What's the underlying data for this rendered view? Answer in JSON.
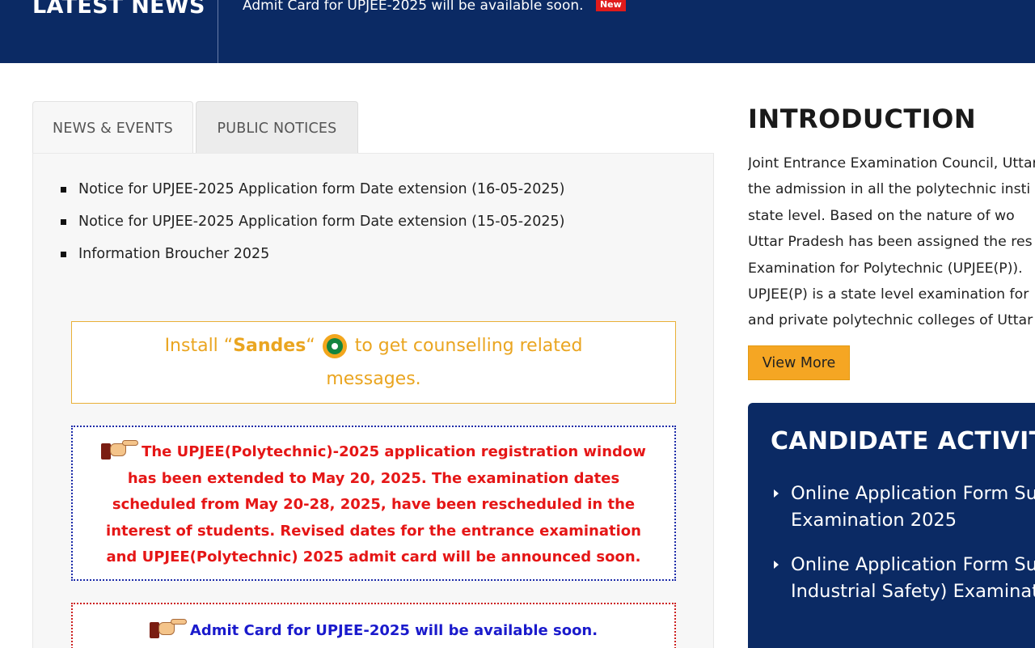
{
  "news_bar": {
    "title": "LATEST NEWS",
    "item": "Admit Card for UPJEE-2025 will be available soon.",
    "badge": "New"
  },
  "tabs": [
    {
      "label": "NEWS & EVENTS",
      "active": true
    },
    {
      "label": "PUBLIC NOTICES",
      "active": false
    }
  ],
  "notices": [
    "Notice for UPJEE-2025 Application form Date extension (16-05-2025)",
    "Notice for UPJEE-2025 Application form Date extension (15-05-2025)",
    "Information Broucher 2025"
  ],
  "sandes": {
    "prefix": "Install “",
    "app_name": "Sandes",
    "suffix_quote": "“",
    "message_line1": "to get counselling related",
    "message_line2": "messages."
  },
  "alert": {
    "text": "The UPJEE(Polytechnic)-2025 application registration window has been extended to May 20, 2025. The examination dates scheduled from May 20-28, 2025, have been rescheduled in the interest of students. Revised dates for the entrance examination and UPJEE(Polytechnic) 2025 admit card will be announced soon."
  },
  "admit_notice": {
    "text": "Admit Card for UPJEE-2025 will be available soon."
  },
  "introduction": {
    "title": "INTRODUCTION",
    "lines": [
      "Joint Entrance Examination Council, Uttar",
      "the admission in all the polytechnic insti",
      "state level. Based on the nature of wo",
      "Uttar Pradesh has been assigned the res",
      "Examination for Polytechnic (UPJEE(P)).",
      "UPJEE(P) is a state level examination for",
      "and private polytechnic colleges of Uttar"
    ],
    "view_more": "View More"
  },
  "candidate_activity": {
    "title": "CANDIDATE ACTIVITY",
    "items": [
      {
        "line1": "Online Application Form Su",
        "line2": "Examination 2025"
      },
      {
        "line1": "Online Application Form Su",
        "line2": "Industrial Safety) Examinat"
      }
    ]
  },
  "colors": {
    "navy": "#0b2a64",
    "accent_orange": "#f5a623",
    "alert_red": "#e51616",
    "admit_blue": "#1a1acc",
    "badge_red": "#e01b1b"
  }
}
